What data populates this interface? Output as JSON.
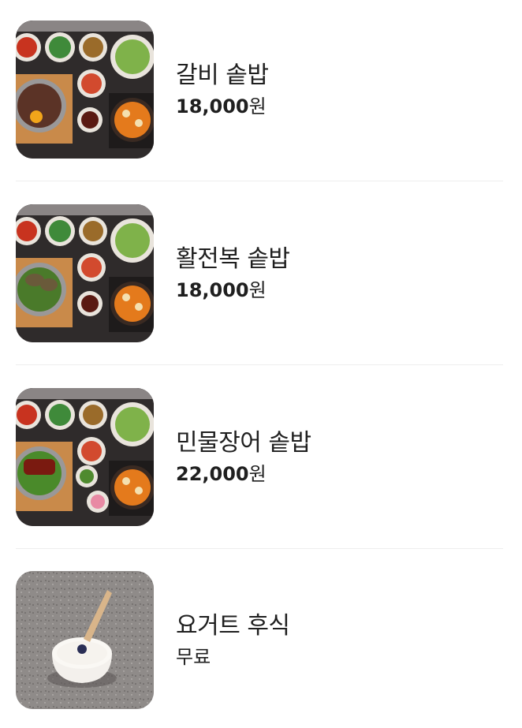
{
  "menu": {
    "items": [
      {
        "name": "갈비 솥밥",
        "price": "18,000",
        "unit": "원",
        "image": "galbi-sotbap-photo"
      },
      {
        "name": "활전복 솥밥",
        "price": "18,000",
        "unit": "원",
        "image": "abalone-sotbap-photo"
      },
      {
        "name": "민물장어 솥밥",
        "price": "22,000",
        "unit": "원",
        "image": "eel-sotbap-photo"
      },
      {
        "name": "요거트 후식",
        "price": "무료",
        "unit": "",
        "image": "yogurt-dessert-photo"
      }
    ]
  },
  "colors": {
    "text": "#1f1f1f",
    "divider": "#eeeeee",
    "tray": "#2e2a2a",
    "wood": "#c98a4a"
  }
}
